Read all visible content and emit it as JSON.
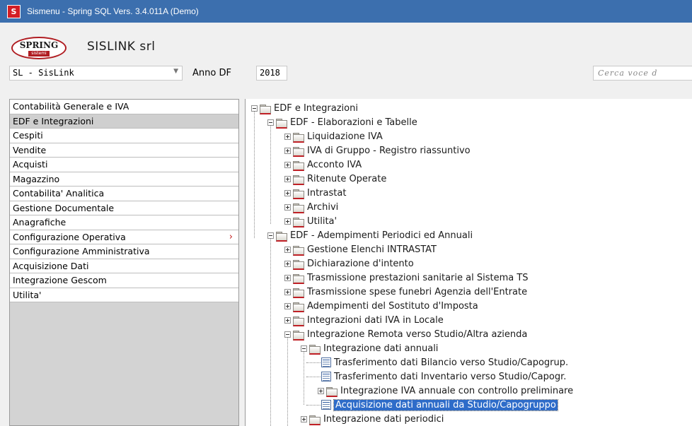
{
  "window": {
    "title": "Sismenu - Spring SQL Vers. 3.4.011A (Demo)",
    "icon_letter": "S"
  },
  "header": {
    "logo_text": "SPRING",
    "logo_sub": "sistemi",
    "company": "SISLINK srl",
    "company_selector": "SL - SisLink",
    "anno_label": "Anno DF",
    "anno_value": "2018",
    "search_placeholder": "Cerca voce d"
  },
  "menu": [
    {
      "label": "Contabilità Generale e IVA"
    },
    {
      "label": "EDF e Integrazioni"
    },
    {
      "label": "Cespiti"
    },
    {
      "label": "Vendite"
    },
    {
      "label": "Acquisti"
    },
    {
      "label": "Magazzino"
    },
    {
      "label": "Contabilita' Analitica"
    },
    {
      "label": "Gestione Documentale"
    },
    {
      "label": "Anagrafiche"
    },
    {
      "label": "Configurazione Operativa"
    },
    {
      "label": "Configurazione Amministrativa"
    },
    {
      "label": "Acquisizione Dati"
    },
    {
      "label": "Integrazione Gescom"
    },
    {
      "label": "Utilita'"
    }
  ],
  "tree": [
    {
      "label": "EDF e Integrazioni"
    },
    {
      "label": "EDF - Elaborazioni e Tabelle"
    },
    {
      "label": "Liquidazione IVA"
    },
    {
      "label": "IVA di Gruppo - Registro riassuntivo"
    },
    {
      "label": "Acconto IVA"
    },
    {
      "label": "Ritenute Operate"
    },
    {
      "label": "Intrastat"
    },
    {
      "label": "Archivi"
    },
    {
      "label": "Utilita'"
    },
    {
      "label": "EDF - Adempimenti Periodici ed Annuali"
    },
    {
      "label": "Gestione Elenchi INTRASTAT"
    },
    {
      "label": "Dichiarazione d'intento"
    },
    {
      "label": "Trasmissione prestazioni sanitarie al Sistema TS"
    },
    {
      "label": "Trasmissione spese funebri Agenzia dell'Entrate"
    },
    {
      "label": "Adempimenti del Sostituto d'Imposta"
    },
    {
      "label": "Integrazioni dati IVA in Locale"
    },
    {
      "label": "Integrazione Remota verso Studio/Altra azienda"
    },
    {
      "label": "Integrazione dati annuali"
    },
    {
      "label": "Trasferimento dati Bilancio verso Studio/Capogrup."
    },
    {
      "label": "Trasferimento dati Inventario verso Studio/Capogr."
    },
    {
      "label": "Integrazione IVA annuale con controllo preliminare"
    },
    {
      "label": "Acquisizione dati annuali da Studio/Capogruppo"
    },
    {
      "label": "Integrazione dati periodici"
    }
  ]
}
